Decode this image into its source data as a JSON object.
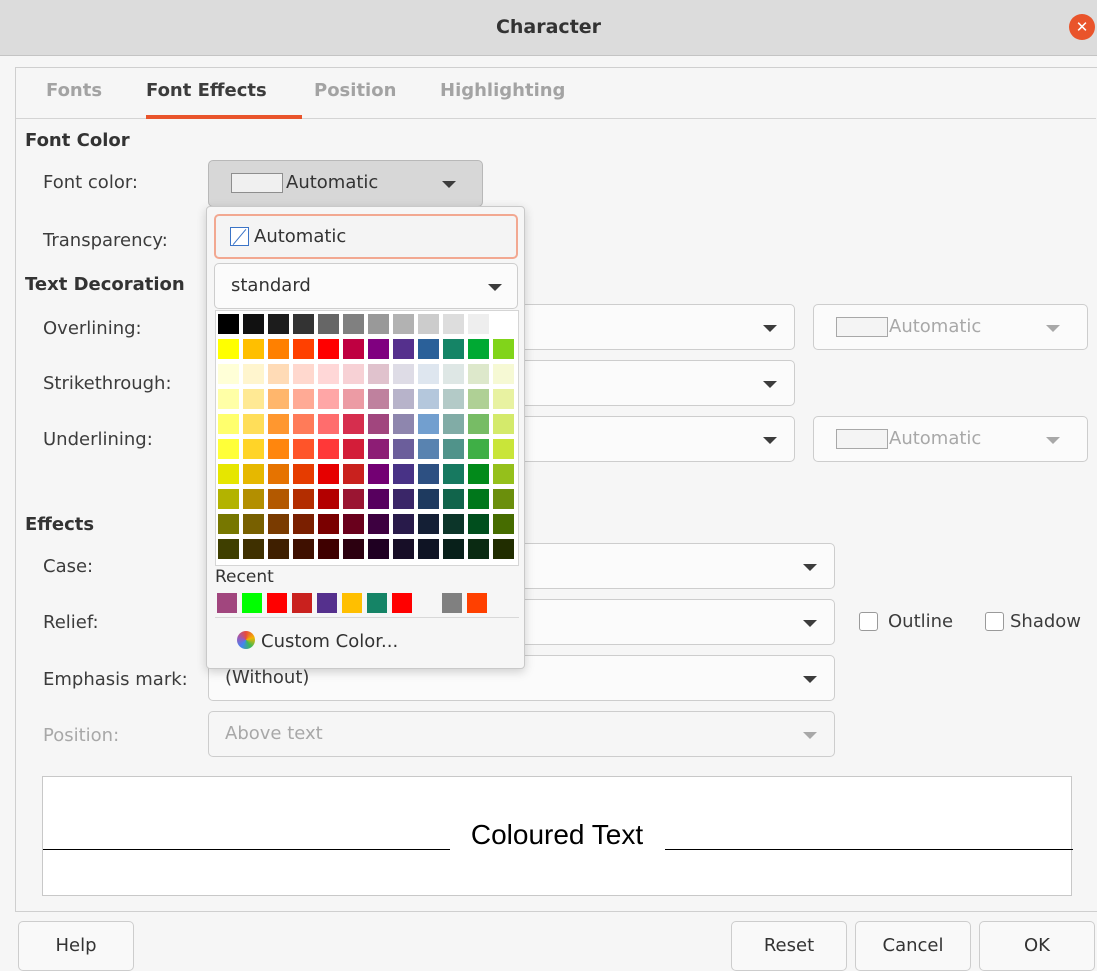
{
  "window": {
    "title": "Character"
  },
  "tabs": [
    {
      "label": "Fonts",
      "active": false
    },
    {
      "label": "Font Effects",
      "active": true
    },
    {
      "label": "Position",
      "active": false
    },
    {
      "label": "Highlighting",
      "active": false
    }
  ],
  "font_color": {
    "section_title": "Font Color",
    "color_label": "Font color:",
    "color_value": "Automatic",
    "transparency_label": "Transparency:"
  },
  "text_decoration": {
    "section_title": "Text Decoration",
    "overlining_label": "Overlining:",
    "overlining_color": "Automatic",
    "strikethrough_label": "Strikethrough:",
    "underlining_label": "Underlining:",
    "underlining_color": "Automatic"
  },
  "effects": {
    "section_title": "Effects",
    "case_label": "Case:",
    "relief_label": "Relief:",
    "outline_label": "Outline",
    "shadow_label": "Shadow",
    "emphasis_label": "Emphasis mark:",
    "emphasis_value": "(Without)",
    "position_label": "Position:",
    "position_value": "Above text"
  },
  "preview": {
    "text": "Coloured Text"
  },
  "buttons": {
    "help": "Help",
    "reset": "Reset",
    "cancel": "Cancel",
    "ok": "OK"
  },
  "color_popup": {
    "automatic_label": "Automatic",
    "palette": "standard",
    "recent_label": "Recent",
    "custom_label": "Custom Color...",
    "colors": [
      [
        "#000000",
        "#111111",
        "#1c1c1c",
        "#333333",
        "#666666",
        "#808080",
        "#999999",
        "#b2b2b2",
        "#cccccc",
        "#dddddd",
        "#eeeeee",
        "#ffffff"
      ],
      [
        "#ffff00",
        "#ffbf00",
        "#ff8000",
        "#ff4000",
        "#ff0000",
        "#bf0041",
        "#800080",
        "#55308d",
        "#2a6099",
        "#158466",
        "#00a933",
        "#81d41a"
      ],
      [
        "#ffffd7",
        "#fff5ce",
        "#ffdbb6",
        "#ffd8ce",
        "#ffd7d7",
        "#f7d1d5",
        "#e0c2cd",
        "#dedce6",
        "#dee6ef",
        "#dee7e5",
        "#dde8cb",
        "#f6f9d4"
      ],
      [
        "#ffffa6",
        "#ffe994",
        "#ffb66c",
        "#ffaa95",
        "#ffa6a6",
        "#ec9ba4",
        "#bf819e",
        "#b7b3ca",
        "#b4c7dc",
        "#b3cac7",
        "#afd095",
        "#e8f2a1"
      ],
      [
        "#ffff6d",
        "#ffde59",
        "#ff972f",
        "#ff7b59",
        "#ff6d6d",
        "#d62e4e",
        "#a1467e",
        "#8e86ae",
        "#729fcf",
        "#81aca6",
        "#77bc65",
        "#d4ea6b"
      ],
      [
        "#ffff38",
        "#ffd428",
        "#ff860d",
        "#ff5429",
        "#ff3838",
        "#d31d39",
        "#8d1d75",
        "#6b5e9b",
        "#5983b0",
        "#50938a",
        "#3faf46",
        "#c9e539"
      ],
      [
        "#e6e600",
        "#e6b800",
        "#e67300",
        "#e63c00",
        "#e60000",
        "#c9211e",
        "#730073",
        "#483286",
        "#2d5082",
        "#177960",
        "#028a1a",
        "#95c01b"
      ],
      [
        "#b3b300",
        "#b38f00",
        "#b35900",
        "#b32d00",
        "#b30000",
        "#9a1532",
        "#57005e",
        "#3a2668",
        "#1e3a5f",
        "#11644b",
        "#00771b",
        "#6b8f0c"
      ],
      [
        "#777700",
        "#786000",
        "#7a3b00",
        "#7a1f00",
        "#7a0000",
        "#69001c",
        "#3d0040",
        "#281a4a",
        "#141f35",
        "#0c3529",
        "#004e1d",
        "#466c00"
      ],
      [
        "#3f3f00",
        "#3f3000",
        "#3f1f00",
        "#3f1000",
        "#3f0000",
        "#2c0010",
        "#1f0022",
        "#170e27",
        "#0f1424",
        "#08201a",
        "#0a2a12",
        "#212d00"
      ]
    ],
    "recent": [
      "#a1467e",
      "#00ff00",
      "#ff0000",
      "#c9211e",
      "#55308d",
      "#ffbf00",
      "#158466",
      "#ff0000",
      "#f6f6f6",
      "#808080",
      "#ff4000"
    ]
  }
}
